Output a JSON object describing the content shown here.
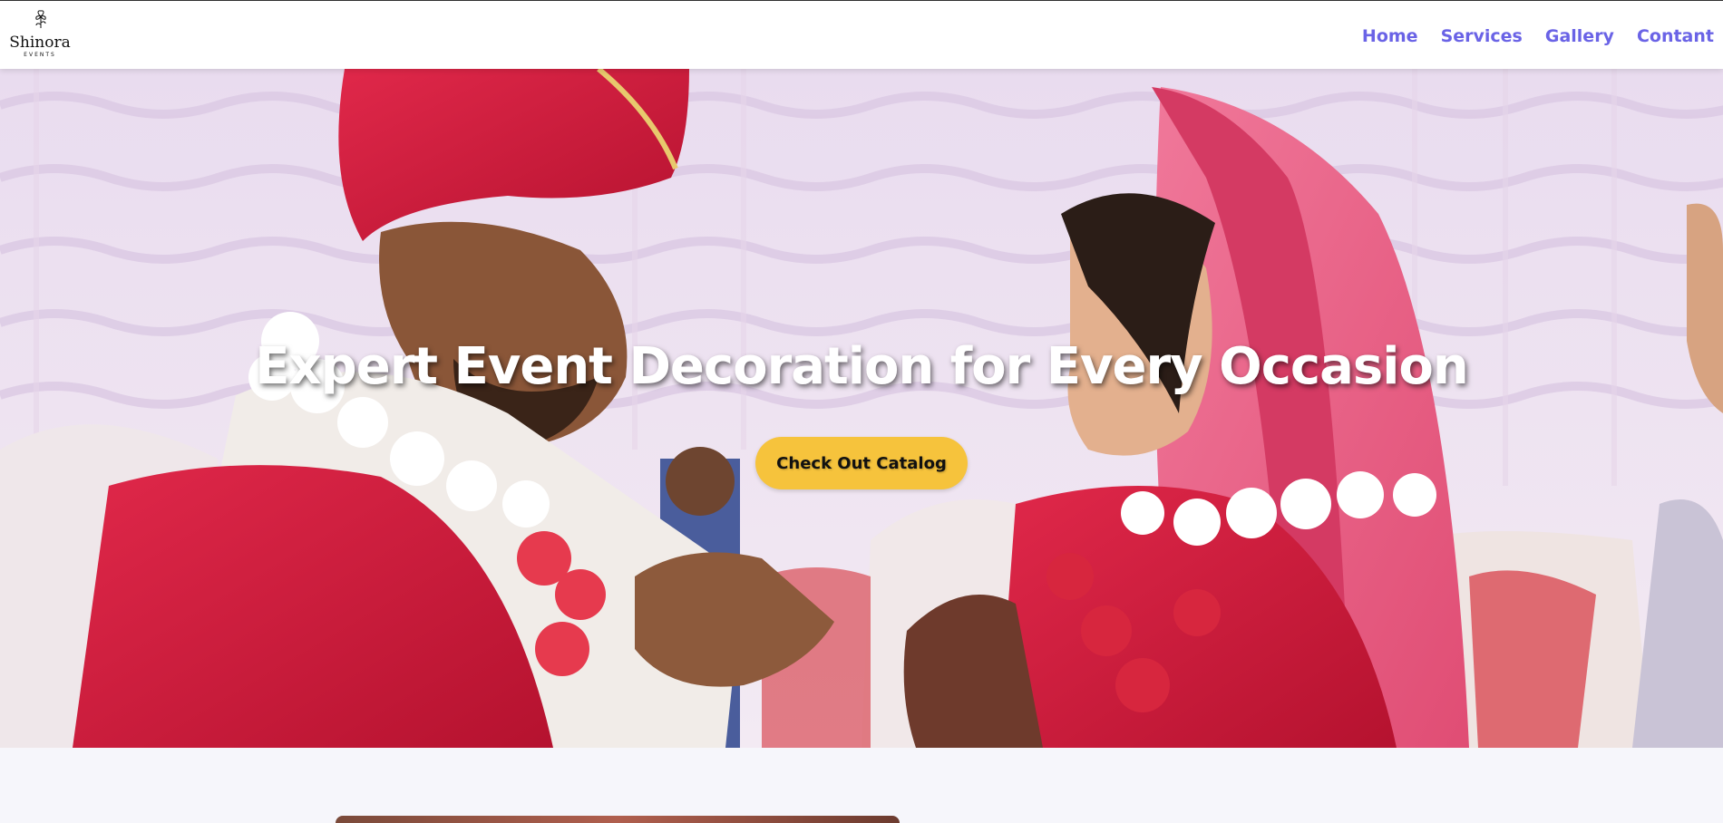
{
  "brand": {
    "name": "Shinora",
    "tagline": "EVENTS"
  },
  "nav": {
    "items": [
      {
        "label": "Home"
      },
      {
        "label": "Services"
      },
      {
        "label": "Gallery"
      },
      {
        "label": "Contant"
      }
    ],
    "color": "#6a63e6"
  },
  "hero": {
    "title": "Expert Event Decoration for Every Occasion",
    "cta_label": "Check Out Catalog",
    "cta_color": "#f6c33c",
    "image_description_icon": "wedding-photo"
  }
}
